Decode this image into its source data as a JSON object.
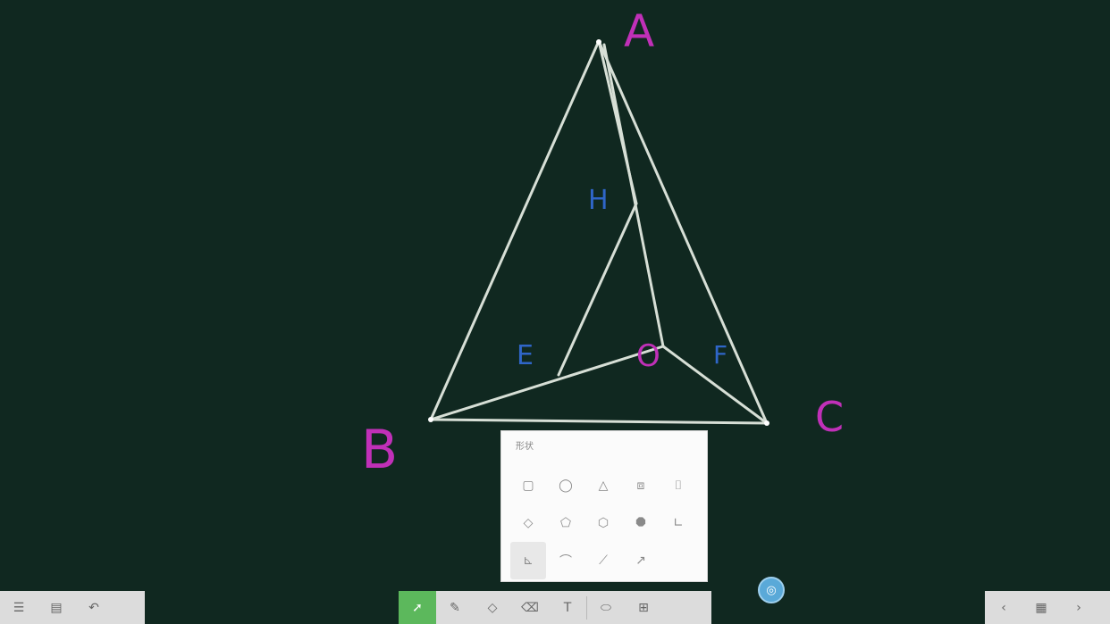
{
  "board": {
    "labels": {
      "A": "A",
      "B": "B",
      "C": "C",
      "inner_H": "H",
      "inner_E": "E",
      "inner_O": "O",
      "inner_F": "F"
    },
    "colors": {
      "background": "#102820",
      "lines": "#d7dfd6",
      "vertex_labels": "#c030b8",
      "inner_labels": "#2f66c8",
      "accent": "#5cb85c"
    }
  },
  "shape_panel": {
    "title": "形状",
    "rows": [
      [
        "square-outline-icon",
        "circle-outline-icon",
        "triangle-outline-icon",
        "cube-icon",
        "cylinder-icon"
      ],
      [
        "diamond-icon",
        "pentagon-icon",
        "hexagon-icon",
        "octagon-icon",
        "right-angle-icon"
      ],
      [
        "axis-icon",
        "arc-icon",
        "line-icon",
        "arrow-line-icon"
      ]
    ],
    "glyphs": {
      "square-outline-icon": "▢",
      "circle-outline-icon": "◯",
      "triangle-outline-icon": "△",
      "cube-icon": "⧈",
      "cylinder-icon": "⌷",
      "diamond-icon": "◇",
      "pentagon-icon": "⬠",
      "hexagon-icon": "⬡",
      "octagon-icon": "⯃",
      "right-angle-icon": "∟",
      "axis-icon": "⊾",
      "arc-icon": "⌒",
      "line-icon": "⟋",
      "arrow-line-icon": "↗"
    },
    "selected": "axis-icon"
  },
  "toolbars": {
    "left": [
      "menu-icon",
      "page-icon",
      "undo-icon"
    ],
    "center": [
      "pointer-icon",
      "pen-icon",
      "shape-icon",
      "eraser-icon",
      "text-icon",
      "lasso-icon",
      "insert-icon"
    ],
    "right": [
      "previous-page-icon",
      "page-list-icon",
      "next-page-icon"
    ],
    "active": "pointer-icon",
    "glyphs": {
      "menu-icon": "☰",
      "page-icon": "▤",
      "undo-icon": "↶",
      "pointer-icon": "➚",
      "pen-icon": "✎",
      "shape-icon": "◇",
      "eraser-icon": "⌫",
      "text-icon": "T",
      "lasso-icon": "⬭",
      "insert-icon": "⊞",
      "previous-page-icon": "‹",
      "page-list-icon": "▦",
      "next-page-icon": "›"
    }
  },
  "fab_glyph": "◎"
}
